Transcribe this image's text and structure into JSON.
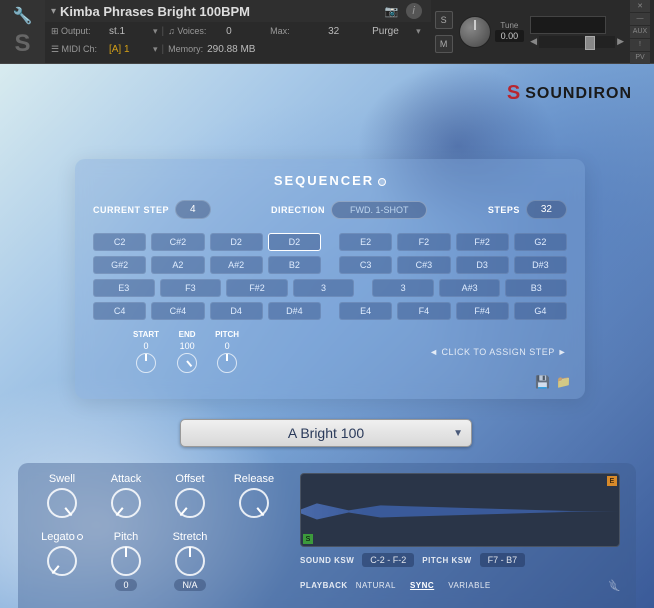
{
  "header": {
    "instrument_name": "Kimba Phrases Bright 100BPM",
    "output_label": "⊞ Output:",
    "output_value": "st.1",
    "voices_label": "♫ Voices:",
    "voices_value": "0",
    "max_label": "Max:",
    "max_value": "32",
    "purge_label": "Purge",
    "midi_label": "☰ MIDI Ch:",
    "midi_value": "[A] 1",
    "memory_label": "Memory:",
    "memory_value": "290.88 MB",
    "solo": "S",
    "mute": "M",
    "tune_label": "Tune",
    "tune_value": "0.00",
    "side": {
      "close": "✕",
      "min": "—",
      "aux": "AUX",
      "exc": "!",
      "pv": "PV"
    }
  },
  "brand": {
    "s": "S",
    "name": "SOUNDIRON"
  },
  "sequencer": {
    "title": "SEQUENCER",
    "current_step_label": "CURRENT STEP",
    "current_step": "4",
    "direction_label": "DIRECTION",
    "direction": "FWD. 1-SHOT",
    "steps_label": "STEPS",
    "steps": "32",
    "selected_index": 3,
    "rows": [
      [
        "C2",
        "C#2",
        "D2",
        "D2",
        "E2",
        "F2",
        "F#2",
        "G2"
      ],
      [
        "G#2",
        "A2",
        "A#2",
        "B2",
        "C3",
        "C#3",
        "D3",
        "D#3"
      ],
      [
        "E3",
        "F3",
        "F#2",
        "3",
        "3",
        "A#3",
        "B3"
      ],
      [
        "C4",
        "C#4",
        "D4",
        "D#4",
        "E4",
        "F4",
        "F#4",
        "G4"
      ]
    ],
    "start_label": "START",
    "start": "0",
    "end_label": "END",
    "end": "100",
    "pitch_label": "PITCH",
    "pitch": "0",
    "assign_hint": "◄ CLICK TO ASSIGN STEP ►"
  },
  "preset": {
    "name": "A Bright 100"
  },
  "perf": {
    "swell": "Swell",
    "attack": "Attack",
    "offset": "Offset",
    "release": "Release",
    "legato": "Legato",
    "pitch_label": "Pitch",
    "pitch_val": "0",
    "stretch_label": "Stretch",
    "stretch_val": "N/A",
    "sound_ksw_label": "SOUND KSW",
    "sound_ksw": "C-2 - F-2",
    "pitch_ksw_label": "PITCH KSW",
    "pitch_ksw": "F7 - B7",
    "playback_label": "PLAYBACK",
    "playback_opts": [
      "NATURAL",
      "SYNC",
      "VARIABLE"
    ],
    "playback_active": "SYNC",
    "wave_s": "S",
    "wave_e": "E"
  }
}
